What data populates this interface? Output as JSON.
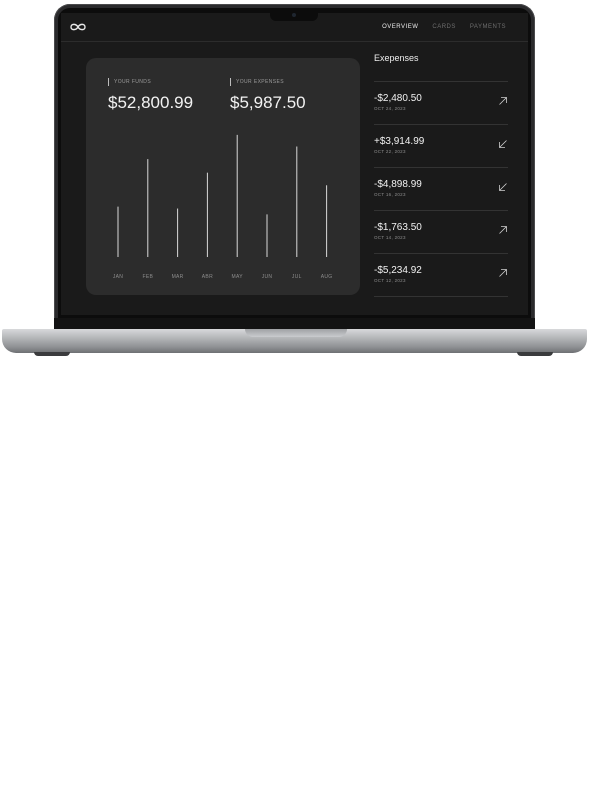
{
  "nav": {
    "items": [
      {
        "label": "OVERVIEW",
        "active": true
      },
      {
        "label": "CARDS",
        "active": false
      },
      {
        "label": "PAYMENTS",
        "active": false
      }
    ]
  },
  "summary": {
    "funds_label": "YOUR FUNDS",
    "funds_value": "$52,800.99",
    "expenses_label": "YOUR EXPENSES",
    "expenses_value": "$5,987.50"
  },
  "chart_data": {
    "type": "bar",
    "categories": [
      "JAN",
      "FEB",
      "MAR",
      "ABR",
      "MAY",
      "JUN",
      "JUL",
      "AUG"
    ],
    "values": [
      52,
      101,
      50,
      87,
      126,
      44,
      114,
      74
    ],
    "ylim": [
      0,
      130
    ],
    "grid": false,
    "color": "#d9d9d9"
  },
  "sidebar": {
    "title": "Exepenses",
    "transactions": [
      {
        "amount": "-$2,480.50",
        "date": "OCT 24, 2023",
        "direction": "outgoing",
        "icon": "arrow-up-right-icon"
      },
      {
        "amount": "+$3,914.99",
        "date": "OCT 22, 2023",
        "direction": "incoming",
        "icon": "arrow-down-left-icon"
      },
      {
        "amount": "-$4,898.99",
        "date": "OCT 16, 2023",
        "direction": "incoming",
        "icon": "arrow-down-left-icon"
      },
      {
        "amount": "-$1,763.50",
        "date": "OCT 14, 2023",
        "direction": "outgoing",
        "icon": "arrow-up-right-icon"
      },
      {
        "amount": "-$5,234.92",
        "date": "OCT 12, 2023",
        "direction": "outgoing",
        "icon": "arrow-up-right-icon"
      }
    ]
  },
  "colors": {
    "screen_bg": "#1a1a1a",
    "card_bg": "#2c2c2c",
    "text_primary": "#f2f2f2",
    "text_muted": "#8d8d8d",
    "laptop_body": "#b6b8bb"
  }
}
